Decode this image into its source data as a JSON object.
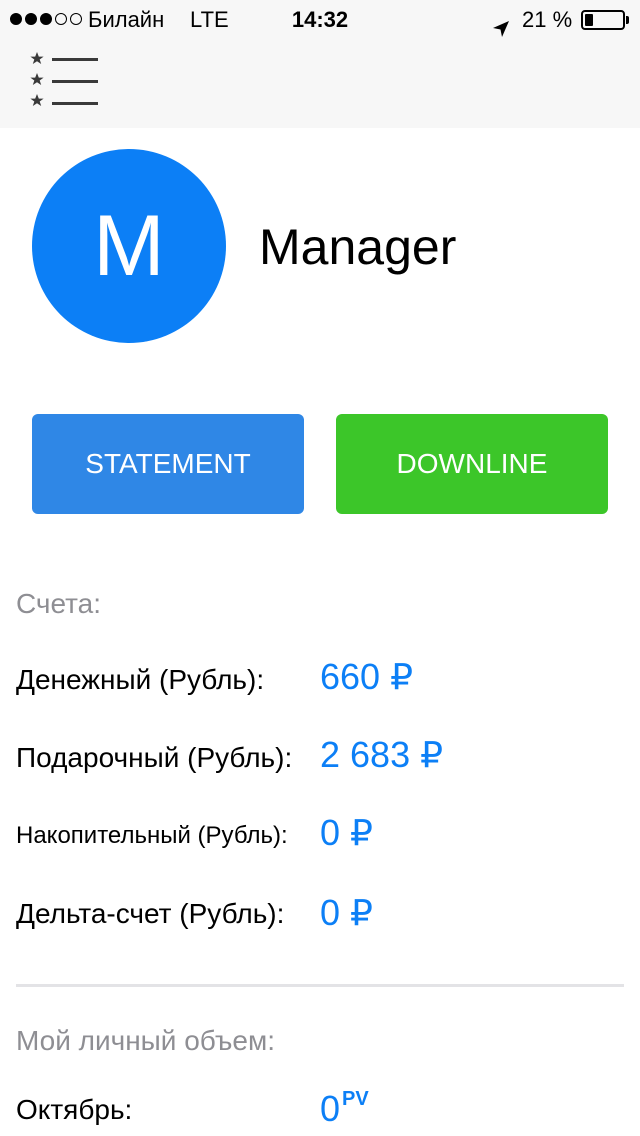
{
  "status_bar": {
    "signal_filled": 3,
    "signal_total": 5,
    "carrier": "Билайн",
    "network": "LTE",
    "time": "14:32",
    "battery_percent": "21 %",
    "battery_level": 0.21
  },
  "header": {
    "menu_icon": "starred-list-menu-icon"
  },
  "profile": {
    "initial": "M",
    "name": "Manager",
    "avatar_color": "#0c7ff6"
  },
  "actions": {
    "statement_label": "STATEMENT",
    "downline_label": "DOWNLINE",
    "statement_color": "#2f87e6",
    "downline_color": "#3cc629"
  },
  "accounts": {
    "heading": "Счета:",
    "items": [
      {
        "label": "Денежный (Рубль):",
        "value": "660 ₽"
      },
      {
        "label": "Подарочный (Рубль):",
        "value": "2 683 ₽"
      },
      {
        "label": "Накопительный (Рубль):",
        "value": "0 ₽"
      },
      {
        "label": "Дельта-счет (Рубль):",
        "value": "0 ₽"
      }
    ]
  },
  "personal_volume": {
    "heading": "Мой личный объем:",
    "month": "Октябрь:",
    "value": "0",
    "unit": "PV"
  }
}
